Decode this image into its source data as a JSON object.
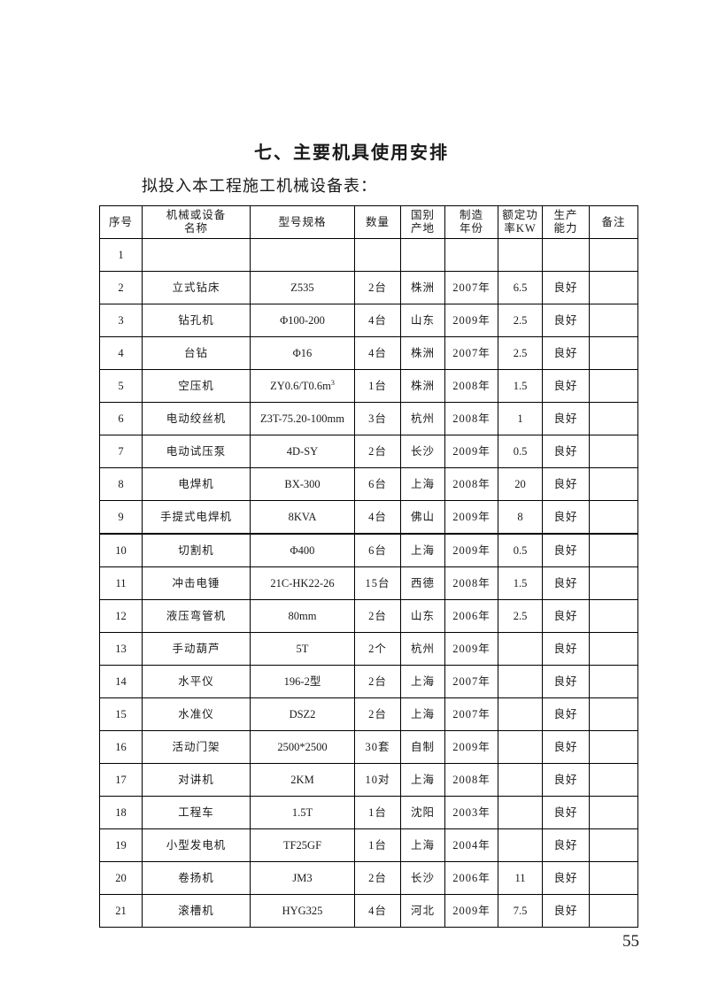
{
  "document": {
    "section_title": "七、主要机具使用安排",
    "sub_title": "拟投入本工程施工机械设备表：",
    "page_number": "55"
  },
  "table": {
    "headers": [
      {
        "line1": "序号",
        "line2": ""
      },
      {
        "line1": "机械或设备",
        "line2": "名称"
      },
      {
        "line1": "型号规格",
        "line2": ""
      },
      {
        "line1": "数量",
        "line2": ""
      },
      {
        "line1": "国别",
        "line2": "产地"
      },
      {
        "line1": "制造",
        "line2": "年份"
      },
      {
        "line1": "额定功",
        "line2": "率KW"
      },
      {
        "line1": "生产",
        "line2": "能力"
      },
      {
        "line1": "备注",
        "line2": ""
      }
    ],
    "rows": [
      {
        "no": "1",
        "name": "",
        "model": "",
        "qty": "",
        "origin": "",
        "year": "",
        "power": "",
        "capacity": "",
        "remark": "",
        "thick_top": false
      },
      {
        "no": "2",
        "name": "立式钻床",
        "model": "Z535",
        "qty": "2台",
        "origin": "株洲",
        "year": "2007年",
        "power": "6.5",
        "capacity": "良好",
        "remark": "",
        "thick_top": false
      },
      {
        "no": "3",
        "name": "钻孔机",
        "model": "Φ100-200",
        "qty": "4台",
        "origin": "山东",
        "year": "2009年",
        "power": "2.5",
        "capacity": "良好",
        "remark": "",
        "thick_top": false
      },
      {
        "no": "4",
        "name": "台钻",
        "model": "Φ16",
        "qty": "4台",
        "origin": "株洲",
        "year": "2007年",
        "power": "2.5",
        "capacity": "良好",
        "remark": "",
        "thick_top": false
      },
      {
        "no": "5",
        "name": "空压机",
        "model": "ZY0.6/T0.6m",
        "model_sup": "3",
        "qty": "1台",
        "origin": "株洲",
        "year": "2008年",
        "power": "1.5",
        "capacity": "良好",
        "remark": "",
        "thick_top": false
      },
      {
        "no": "6",
        "name": "电动绞丝机",
        "model": "Z3T-75.20-100mm",
        "qty": "3台",
        "origin": "杭州",
        "year": "2008年",
        "power": "1",
        "capacity": "良好",
        "remark": "",
        "thick_top": false
      },
      {
        "no": "7",
        "name": "电动试压泵",
        "model": "4D-SY",
        "qty": "2台",
        "origin": "长沙",
        "year": "2009年",
        "power": "0.5",
        "capacity": "良好",
        "remark": "",
        "thick_top": false
      },
      {
        "no": "8",
        "name": "电焊机",
        "model": "BX-300",
        "qty": "6台",
        "origin": "上海",
        "year": "2008年",
        "power": "20",
        "capacity": "良好",
        "remark": "",
        "thick_top": false
      },
      {
        "no": "9",
        "name": "手提式电焊机",
        "model": "8KVA",
        "qty": "4台",
        "origin": "佛山",
        "year": "2009年",
        "power": "8",
        "capacity": "良好",
        "remark": "",
        "thick_top": false
      },
      {
        "no": "10",
        "name": "切割机",
        "model": "Φ400",
        "qty": "6台",
        "origin": "上海",
        "year": "2009年",
        "power": "0.5",
        "capacity": "良好",
        "remark": "",
        "thick_top": true
      },
      {
        "no": "11",
        "name": "冲击电锤",
        "model": "21C-HK22-26",
        "qty": "15台",
        "origin": "西德",
        "year": "2008年",
        "power": "1.5",
        "capacity": "良好",
        "remark": "",
        "thick_top": false
      },
      {
        "no": "12",
        "name": "液压弯管机",
        "model": "80mm",
        "qty": "2台",
        "origin": "山东",
        "year": "2006年",
        "power": "2.5",
        "capacity": "良好",
        "remark": "",
        "thick_top": false
      },
      {
        "no": "13",
        "name": "手动葫芦",
        "model": "5T",
        "qty": "2个",
        "origin": "杭州",
        "year": "2009年",
        "power": "",
        "capacity": "良好",
        "remark": "",
        "thick_top": false
      },
      {
        "no": "14",
        "name": "水平仪",
        "model": "196-2型",
        "qty": "2台",
        "origin": "上海",
        "year": "2007年",
        "power": "",
        "capacity": "良好",
        "remark": "",
        "thick_top": false
      },
      {
        "no": "15",
        "name": "水准仪",
        "model": "DSZ2",
        "qty": "2台",
        "origin": "上海",
        "year": "2007年",
        "power": "",
        "capacity": "良好",
        "remark": "",
        "thick_top": false
      },
      {
        "no": "16",
        "name": "活动门架",
        "model": "2500*2500",
        "qty": "30套",
        "origin": "自制",
        "year": "2009年",
        "power": "",
        "capacity": "良好",
        "remark": "",
        "thick_top": false
      },
      {
        "no": "17",
        "name": "对讲机",
        "model": "2KM",
        "qty": "10对",
        "origin": "上海",
        "year": "2008年",
        "power": "",
        "capacity": "良好",
        "remark": "",
        "thick_top": false
      },
      {
        "no": "18",
        "name": "工程车",
        "model": "1.5T",
        "qty": "1台",
        "origin": "沈阳",
        "year": "2003年",
        "power": "",
        "capacity": "良好",
        "remark": "",
        "thick_top": false
      },
      {
        "no": "19",
        "name": "小型发电机",
        "model": "TF25GF",
        "qty": "1台",
        "origin": "上海",
        "year": "2004年",
        "power": "",
        "capacity": "良好",
        "remark": "",
        "thick_top": false
      },
      {
        "no": "20",
        "name": "卷扬机",
        "model": "JM3",
        "qty": "2台",
        "origin": "长沙",
        "year": "2006年",
        "power": "11",
        "capacity": "良好",
        "remark": "",
        "thick_top": false
      },
      {
        "no": "21",
        "name": "滚槽机",
        "model": "HYG325",
        "qty": "4台",
        "origin": "河北",
        "year": "2009年",
        "power": "7.5",
        "capacity": "良好",
        "remark": "",
        "thick_top": false
      }
    ]
  }
}
